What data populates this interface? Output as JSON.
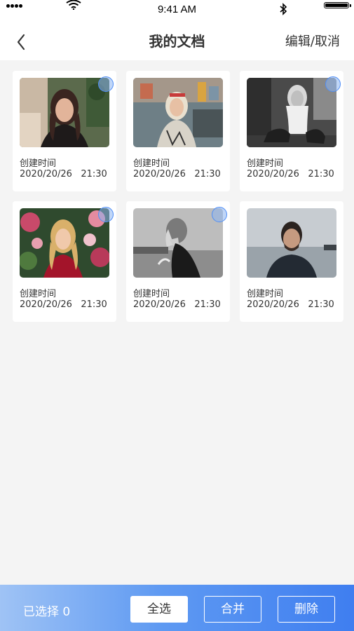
{
  "status_bar": {
    "time": "9:41 AM"
  },
  "nav": {
    "title": "我的文档",
    "edit_label": "编辑/取消"
  },
  "documents": [
    {
      "label": "创建时间",
      "date": "2020/20/26   21:30",
      "selected": true
    },
    {
      "label": "创建时间",
      "date": "2020/20/26   21:30",
      "selected": false
    },
    {
      "label": "创建时间",
      "date": "2020/20/26   21:30",
      "selected": true
    },
    {
      "label": "创建时间",
      "date": "2020/20/26   21:30",
      "selected": true
    },
    {
      "label": "创建时间",
      "date": "2020/20/26   21:30",
      "selected": true
    },
    {
      "label": "创建时间",
      "date": "2020/20/26   21:30",
      "selected": false
    }
  ],
  "footer": {
    "selected_label": "已选择 0",
    "select_all": "全选",
    "merge": "合并",
    "delete": "删除"
  },
  "colors": {
    "accent": "#4f8ef7",
    "footer_start": "#9fc3f5",
    "footer_end": "#3f7ef0"
  }
}
